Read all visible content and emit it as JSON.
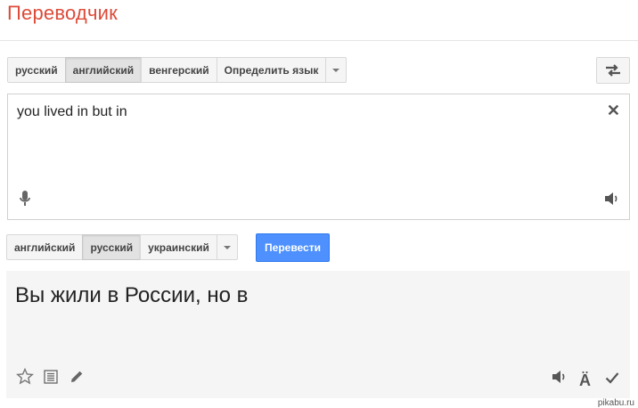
{
  "header": {
    "title": "Переводчик"
  },
  "source": {
    "languages": [
      {
        "label": "русский",
        "active": false
      },
      {
        "label": "английский",
        "active": true
      },
      {
        "label": "венгерский",
        "active": false
      },
      {
        "label": "Определить язык",
        "active": false
      }
    ],
    "text": "you lived in but in"
  },
  "target": {
    "languages": [
      {
        "label": "английский",
        "active": false
      },
      {
        "label": "русский",
        "active": true
      },
      {
        "label": "украинский",
        "active": false
      }
    ],
    "translate_label": "Перевести",
    "text": "Вы жили в России, но в"
  },
  "icons": {
    "swap": "swap-arrows-icon",
    "clear": "close-icon",
    "mic": "microphone-icon",
    "source_listen": "speaker-icon",
    "star": "star-icon",
    "phrasebook": "list-icon",
    "edit": "pencil-icon",
    "target_listen": "speaker-icon",
    "romanization": "a-umlaut-icon",
    "check": "checkmark-icon"
  },
  "colors": {
    "brand": "#dd4b39",
    "primary_button": "#4d90fe"
  },
  "watermark": "pikabu.ru"
}
